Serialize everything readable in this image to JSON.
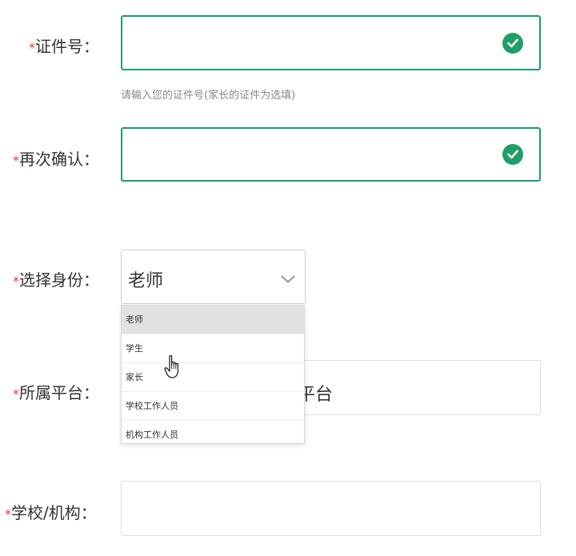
{
  "form": {
    "id_number": {
      "required_mark": "*",
      "label": "证件号：",
      "value": "",
      "hint": "请输入您的证件号(家长的证件为选填)"
    },
    "confirm": {
      "required_mark": "*",
      "label": "再次确认：",
      "value": ""
    },
    "identity": {
      "required_mark": "*",
      "label": "选择身份：",
      "selected": "老师",
      "options": [
        "老师",
        "学生",
        "家长",
        "学校工作人员",
        "机构工作人员"
      ]
    },
    "platform": {
      "required_mark": "*",
      "label": "所属平台：",
      "partial_value": "平台"
    },
    "school": {
      "required_mark": "*",
      "label": "学校/机构：",
      "value": ""
    }
  },
  "colors": {
    "valid_border": "#1e9e6a",
    "required": "#e53935"
  },
  "icons": {
    "valid": "check-circle-icon",
    "select": "chevron-down-icon",
    "cursor": "hand-pointer-icon"
  }
}
